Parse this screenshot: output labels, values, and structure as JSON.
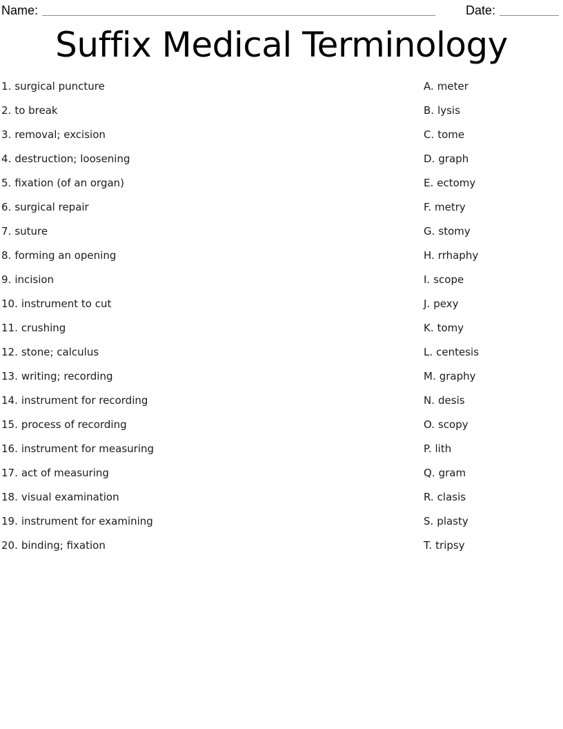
{
  "header": {
    "name_label": "Name:",
    "date_label": "Date:"
  },
  "title": "Suffix Medical Terminology",
  "worksheet": {
    "prompts": [
      {
        "number": "1.",
        "text": "surgical puncture"
      },
      {
        "number": "2.",
        "text": "to break"
      },
      {
        "number": "3.",
        "text": "removal; excision"
      },
      {
        "number": "4.",
        "text": "destruction; loosening"
      },
      {
        "number": "5.",
        "text": "fixation (of an organ)"
      },
      {
        "number": "6.",
        "text": "surgical repair"
      },
      {
        "number": "7.",
        "text": "suture"
      },
      {
        "number": "8.",
        "text": "forming an opening"
      },
      {
        "number": "9.",
        "text": "incision"
      },
      {
        "number": "10.",
        "text": "instrument to cut"
      },
      {
        "number": "11.",
        "text": "crushing"
      },
      {
        "number": "12.",
        "text": "stone; calculus"
      },
      {
        "number": "13.",
        "text": "writing; recording"
      },
      {
        "number": "14.",
        "text": "instrument for recording"
      },
      {
        "number": "15.",
        "text": "process of recording"
      },
      {
        "number": "16.",
        "text": "instrument for measuring"
      },
      {
        "number": "17.",
        "text": "act of measuring"
      },
      {
        "number": "18.",
        "text": "visual examination"
      },
      {
        "number": "19.",
        "text": "instrument for examining"
      },
      {
        "number": "20.",
        "text": "binding; fixation"
      }
    ],
    "answers": [
      {
        "letter": "A.",
        "text": "meter"
      },
      {
        "letter": "B.",
        "text": "lysis"
      },
      {
        "letter": "C.",
        "text": "tome"
      },
      {
        "letter": "D.",
        "text": "graph"
      },
      {
        "letter": "E.",
        "text": "ectomy"
      },
      {
        "letter": "F.",
        "text": "metry"
      },
      {
        "letter": "G.",
        "text": "stomy"
      },
      {
        "letter": "H.",
        "text": "rrhaphy"
      },
      {
        "letter": "I.",
        "text": "scope"
      },
      {
        "letter": "J.",
        "text": "pexy"
      },
      {
        "letter": "K.",
        "text": "tomy"
      },
      {
        "letter": "L.",
        "text": "centesis"
      },
      {
        "letter": "M.",
        "text": "graphy"
      },
      {
        "letter": "N.",
        "text": "desis"
      },
      {
        "letter": "O.",
        "text": "scopy"
      },
      {
        "letter": "P.",
        "text": "lith"
      },
      {
        "letter": "Q.",
        "text": "gram"
      },
      {
        "letter": "R.",
        "text": "clasis"
      },
      {
        "letter": "S.",
        "text": "plasty"
      },
      {
        "letter": "T.",
        "text": "tripsy"
      }
    ]
  }
}
